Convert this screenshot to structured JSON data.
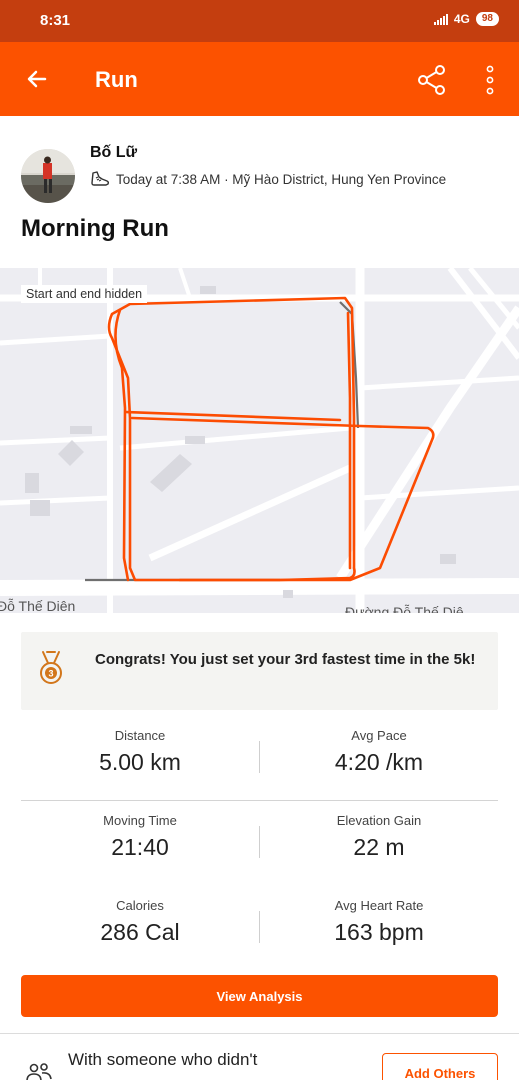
{
  "status_bar": {
    "time": "8:31",
    "network": "4G",
    "battery": "98",
    "icons": [
      "signal-icon",
      "battery-icon"
    ]
  },
  "app_bar": {
    "title": "Run",
    "icons": [
      "back-arrow-icon",
      "share-icon",
      "more-vertical-icon"
    ]
  },
  "athlete": {
    "name": "Bố Lữ",
    "meta": "Today at 7:38 AM · Mỹ Hào District, Hung Yen Province",
    "icons": [
      "avatar",
      "shoe-icon"
    ]
  },
  "activity": {
    "title": "Morning Run"
  },
  "map": {
    "note": "Start and end hidden",
    "street_left": "Đỗ Thế Diên",
    "street_right": "Đường Đỗ Thế Diê",
    "route_color": "#fc4c02",
    "hidden_route_color": "#6f6f6f"
  },
  "achievement": {
    "text": "Congrats! You just set your 3rd fastest time in the 5k!",
    "icon": "medal-icon",
    "medal_rank": "3"
  },
  "stats": [
    {
      "label": "Distance",
      "value": "5.00 km"
    },
    {
      "label": "Avg Pace",
      "value": "4:20 /km"
    },
    {
      "label": "Moving Time",
      "value": "21:40"
    },
    {
      "label": "Elevation Gain",
      "value": "22 m"
    },
    {
      "label": "Calories",
      "value": "286 Cal"
    },
    {
      "label": "Avg Heart Rate",
      "value": "163 bpm"
    }
  ],
  "actions": {
    "view_analysis": "View Analysis",
    "add_others": "Add Others"
  },
  "footer": {
    "text": "With someone who didn't",
    "icon": "people-icon"
  },
  "colors": {
    "brand": "#fc5200",
    "status_bar": "#c43e0f"
  }
}
